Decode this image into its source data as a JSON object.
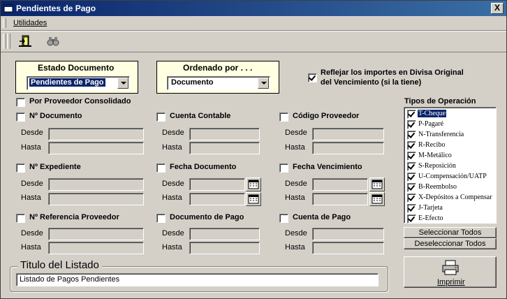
{
  "window": {
    "title": "Pendientes de Pago",
    "close_label": "X"
  },
  "menu": {
    "items": [
      {
        "label": "Utilidades"
      }
    ]
  },
  "toolbar": {
    "buttons": [
      {
        "icon": "exit-door-icon"
      },
      {
        "icon": "binoculars-icon"
      }
    ]
  },
  "estado": {
    "label": "Estado Documento",
    "value": "Pendientes de Pago"
  },
  "ordenado": {
    "label": "Ordenado por . . .",
    "value": "Documento"
  },
  "reflejar": {
    "line1": "Reflejar los importes en Divisa Original",
    "line2": "del Vencimiento (si la tiene)",
    "checked": true
  },
  "consolidado": {
    "label": "Por Proveedor Consolidado",
    "checked": false
  },
  "range_labels": {
    "from": "Desde",
    "to": "Hasta"
  },
  "filters": {
    "n_documento": "Nº Documento",
    "cuenta_contable": "Cuenta Contable",
    "codigo_proveedor": "Código Proveedor",
    "n_expediente": "Nº Expediente",
    "fecha_documento": "Fecha Documento",
    "fecha_vencimiento": "Fecha Vencimiento",
    "n_referencia": "Nº Referencia Proveedor",
    "documento_pago": "Documento de Pago",
    "cuenta_pago": "Cuenta de Pago"
  },
  "tipos": {
    "label": "Tipos de Operación",
    "items": [
      {
        "label": "T-Cheque",
        "checked": true
      },
      {
        "label": "P-Pagaré",
        "checked": true
      },
      {
        "label": "N-Transferencia",
        "checked": true
      },
      {
        "label": "R-Recibo",
        "checked": true
      },
      {
        "label": "M-Metálico",
        "checked": true
      },
      {
        "label": "S-Reposición",
        "checked": true
      },
      {
        "label": "U-Compensación/UATP",
        "checked": true
      },
      {
        "label": "B-Reembolso",
        "checked": true
      },
      {
        "label": "X-Depósitos a Compensar",
        "checked": true
      },
      {
        "label": "J-Tarjeta",
        "checked": true
      },
      {
        "label": "E-Efecto",
        "checked": true
      }
    ],
    "select_all": "Seleccionar Todos",
    "deselect_all": "Deseleccionar Todos"
  },
  "titulo": {
    "label": "Titulo del Listado",
    "value": "Listado de Pagos Pendientes"
  },
  "imprimir": {
    "label": "Imprimir",
    "icon": "printer-icon"
  }
}
